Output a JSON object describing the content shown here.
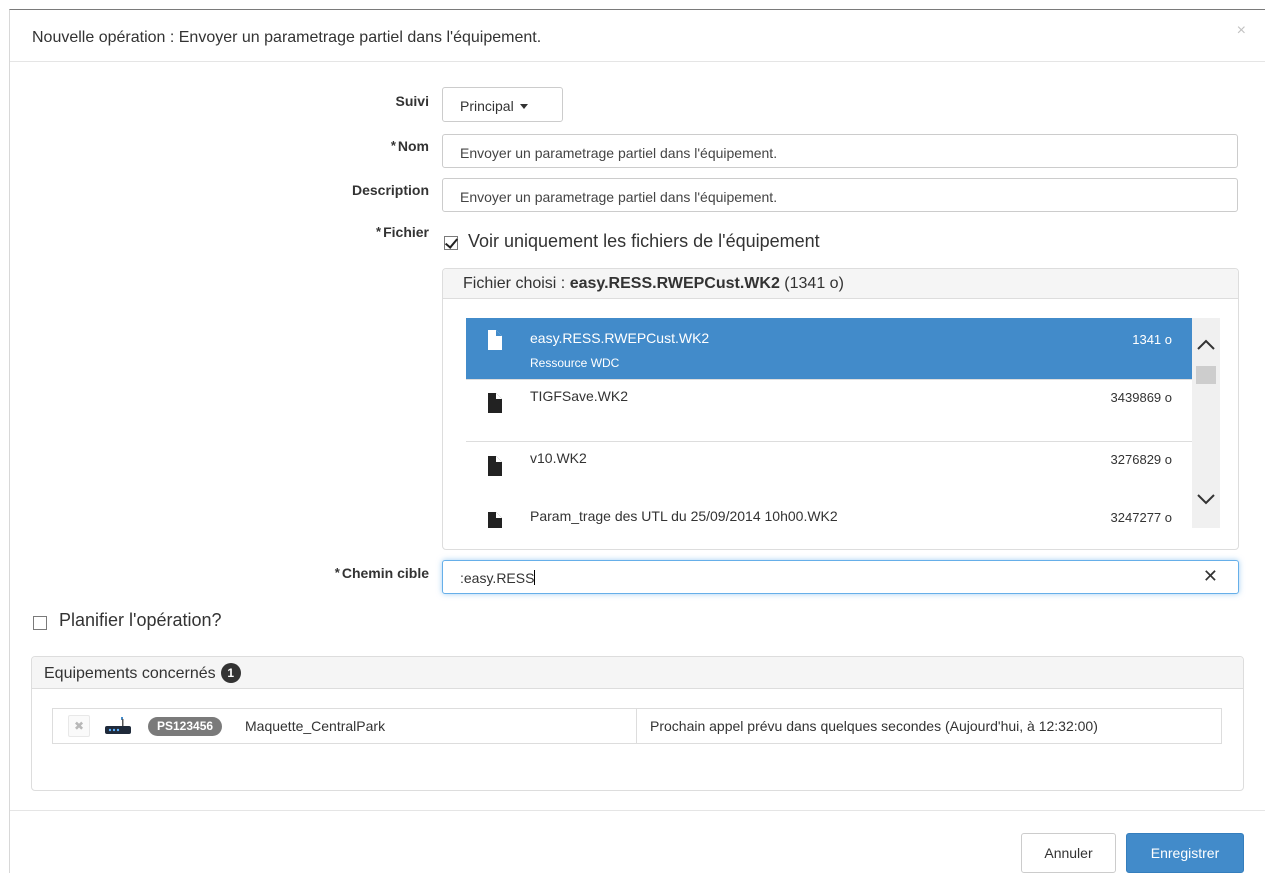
{
  "modal": {
    "title": "Nouvelle opération : Envoyer un parametrage partiel dans l'équipement.",
    "close_symbol": "×"
  },
  "form": {
    "required_marker": "*",
    "suivi": {
      "label": "Suivi",
      "value": "Principal"
    },
    "nom": {
      "label": "Nom",
      "value": "Envoyer un parametrage partiel dans l'équipement."
    },
    "description": {
      "label": "Description",
      "value": "Envoyer un parametrage partiel dans l'équipement."
    },
    "fichier": {
      "label": "Fichier",
      "filter_checkbox_label": "Voir uniquement les fichiers de l'équipement",
      "filter_checked": true,
      "chosen_prefix": "Fichier choisi :",
      "chosen_name": "easy.RESS.RWEPCust.WK2",
      "chosen_size": "(1341 o)",
      "files": [
        {
          "name": "easy.RESS.RWEPCust.WK2",
          "subtitle": "Ressource WDC",
          "size": "1341 o",
          "selected": true
        },
        {
          "name": "TIGFSave.WK2",
          "subtitle": "",
          "size": "3439869 o",
          "selected": false
        },
        {
          "name": "v10.WK2",
          "subtitle": "",
          "size": "3276829 o",
          "selected": false
        },
        {
          "name": "Param_trage des UTL du 25/09/2014 10h00.WK2",
          "subtitle": "",
          "size": "3247277 o",
          "selected": false
        }
      ]
    },
    "chemin_cible": {
      "label": "Chemin cible",
      "value": ":easy.RESS",
      "clear_symbol": "✕"
    }
  },
  "planifier": {
    "label": "Planifier l'opération?",
    "checked": false
  },
  "equipements": {
    "heading": "Equipements concernés",
    "count": "1",
    "rows": [
      {
        "remove_symbol": "✖",
        "id": "PS123456",
        "name": "Maquette_CentralPark",
        "status": "Prochain appel prévu dans quelques secondes (Aujourd'hui, à 12:32:00)"
      }
    ]
  },
  "footer": {
    "cancel_label": "Annuler",
    "save_label": "Enregistrer"
  },
  "colors": {
    "primary": "#428bca",
    "focus_border": "#66afe9",
    "badge_grey": "#7a7a7a"
  }
}
